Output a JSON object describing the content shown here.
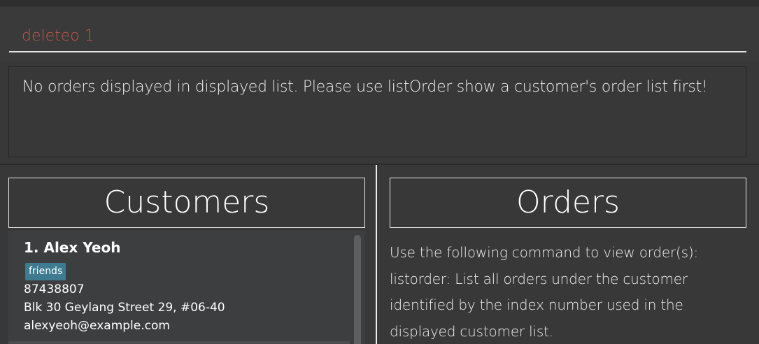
{
  "command": {
    "value": "deleteo 1"
  },
  "result": {
    "message": "No orders displayed in displayed list. Please use listOrder show a customer's order list first!"
  },
  "customers_panel": {
    "title": "Customers",
    "items": [
      {
        "name": "1. Alex Yeoh",
        "tags": [
          "friends"
        ],
        "phone": "87438807",
        "address": "Blk 30 Geylang Street 29, #06-40",
        "email": "alexyeoh@example.com"
      }
    ]
  },
  "orders_panel": {
    "title": "Orders",
    "help_lines": [
      "Use the following command to view order(s):",
      "listorder: List all orders under the customer",
      "identified by the index number used in the",
      "displayed customer list."
    ]
  },
  "colors": {
    "background": "#383838",
    "command_text": "#c0574c",
    "tag_bg": "#3e7b91",
    "text": "#ffffff"
  }
}
